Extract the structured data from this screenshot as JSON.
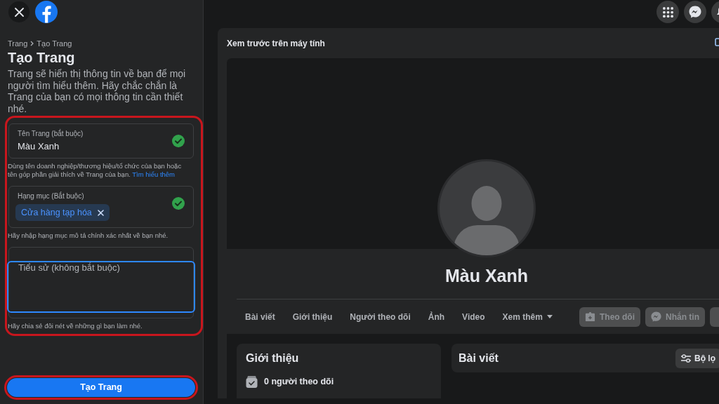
{
  "left_panel": {
    "breadcrumb": [
      "Trang",
      "Tạo Trang"
    ],
    "title": "Tạo Trang",
    "description": "Trang sẽ hiển thị thông tin về bạn để mọi người tìm hiểu thêm. Hãy chắc chắn là Trang của bạn có mọi thông tin cần thiết nhé.",
    "fields": [
      {
        "kind": "text",
        "label": "Tên Trang (bắt buộc)",
        "value": "Màu Xanh",
        "valid": true,
        "help": "Dùng tên doanh nghiệp/thương hiệu/tổ chức của bạn hoặc tên góp phần giải thích về Trang của bạn.",
        "help_link": "Tìm hiểu thêm"
      },
      {
        "kind": "tags",
        "label": "Hạng mục (Bắt buộc)",
        "tags": [
          "Cửa hàng tạp hóa"
        ],
        "valid": true,
        "help": "Hãy nhập hạng mục mô tả chính xác nhất về bạn nhé."
      },
      {
        "kind": "textarea",
        "placeholder": "Tiểu sử (không bắt buộc)",
        "focused": true,
        "help": "Hãy chia sẻ đôi nét về những gì bạn làm nhé."
      }
    ],
    "submit_button": "Tạo Trang"
  },
  "preview": {
    "title": "Xem trước trên máy tính",
    "page_name": "Màu Xanh",
    "tabs": [
      {
        "kind": "tab",
        "label": "Bài viết",
        "selected": false
      },
      {
        "kind": "tab",
        "label": "Giới thiệu",
        "selected": false
      },
      {
        "kind": "tab",
        "label": "Người theo dõi",
        "selected": false
      },
      {
        "kind": "tab",
        "label": "Ảnh",
        "selected": false
      },
      {
        "kind": "tab",
        "label": "Video",
        "selected": false
      },
      {
        "kind": "menu",
        "label": "Xem thêm",
        "selected": false
      }
    ],
    "actions": [
      {
        "kind": "follow",
        "label": "Theo dõi",
        "disabled": true
      },
      {
        "kind": "message",
        "label": "Nhắn tin",
        "disabled": true
      },
      {
        "kind": "more",
        "disabled": true
      }
    ],
    "intro": {
      "title": "Giới thiệu",
      "items": [
        {
          "kind": "followers",
          "text": "0 người theo dõi"
        }
      ]
    },
    "posts": {
      "title": "Bài viết",
      "filter_button": "Bộ lọ"
    }
  }
}
